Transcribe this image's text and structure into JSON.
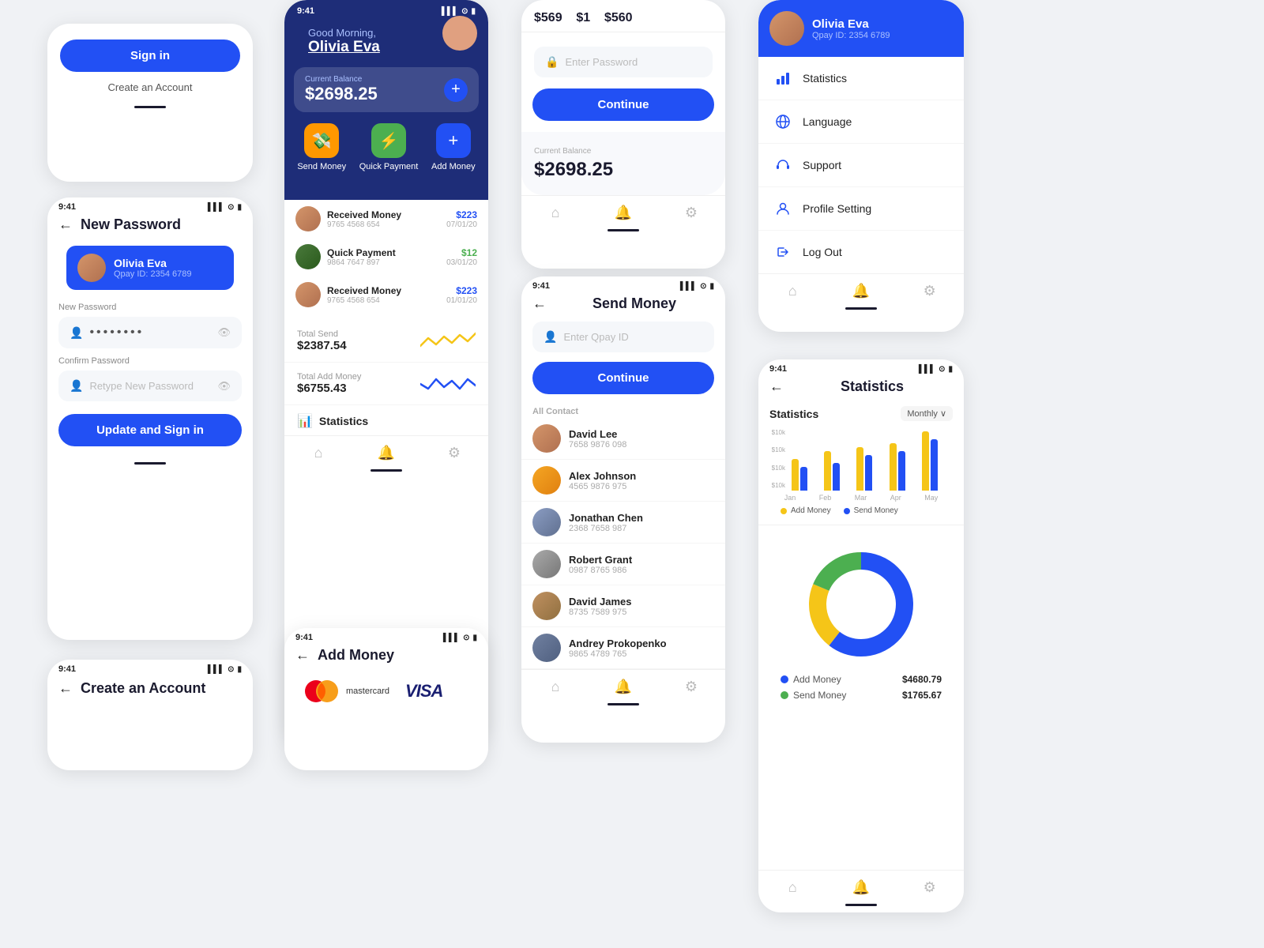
{
  "status": {
    "time": "9:41",
    "signal": "▌▌▌",
    "wifi": "WiFi",
    "battery": "🔋"
  },
  "signin": {
    "title": "Sign in",
    "create_account": "Create an Account"
  },
  "new_password": {
    "title": "New Password",
    "user_name": "Olivia Eva",
    "user_id": "Qpay ID: 2354 6789",
    "new_password_label": "New Password",
    "dots": "••••••••",
    "confirm_label": "Confirm Password",
    "retype_placeholder": "Retype New Password",
    "update_btn": "Update and Sign in"
  },
  "create_account": {
    "title": "Create an Account"
  },
  "dashboard": {
    "greeting": "Good Morning,",
    "name": "Olivia Eva",
    "balance_label": "Current Balance",
    "balance": "$2698.25",
    "actions": [
      {
        "label": "Send Money",
        "icon": "💸"
      },
      {
        "label": "Quick Payment",
        "icon": "⚡"
      },
      {
        "label": "Add Money",
        "icon": "+"
      }
    ],
    "total_send_label": "Total Send",
    "total_send": "$2387.54",
    "total_add_label": "Total Add Money",
    "total_add": "$6755.43",
    "statistics_label": "Statistics",
    "transactions": [
      {
        "name": "Received Money",
        "num": "9765 4568 654",
        "amount": "$223",
        "date": "07/01/20"
      },
      {
        "name": "Quick Payment",
        "num": "9864 7647 897",
        "amount": "$12",
        "date": "03/01/20"
      },
      {
        "name": "Received Money",
        "num": "9765 4568 654",
        "amount": "$223",
        "date": "01/01/20"
      }
    ]
  },
  "addmoney": {
    "title": "Add Money"
  },
  "enter_password": {
    "label": "Enter Password",
    "continue_btn": "Continue",
    "amounts": [
      "$569",
      "$1",
      "$560"
    ]
  },
  "balance_card": {
    "label": "Current Balance",
    "amount": "$2698.25"
  },
  "send_money": {
    "title": "Send Money",
    "qpay_placeholder": "Enter Qpay ID",
    "continue_btn": "Continue",
    "all_contact_label": "All Contact",
    "contacts": [
      {
        "name": "David Lee",
        "num": "7658 9876 098"
      },
      {
        "name": "Alex Johnson",
        "num": "4565 9876 975"
      },
      {
        "name": "Jonathan Chen",
        "num": "2368 7658 987"
      },
      {
        "name": "Robert Grant",
        "num": "0987 8765 986"
      },
      {
        "name": "David James",
        "num": "8735 7589 975"
      },
      {
        "name": "Andrey Prokopenko",
        "num": "9865 4789 765"
      }
    ]
  },
  "profile_menu": {
    "user_name": "Olivia Eva",
    "user_id": "Qpay ID: 2354 6789",
    "items": [
      {
        "label": "Statistics",
        "icon": "bar_chart"
      },
      {
        "label": "Language",
        "icon": "language"
      },
      {
        "label": "Support",
        "icon": "headset"
      },
      {
        "label": "Profile Setting",
        "icon": "person"
      },
      {
        "label": "Log Out",
        "icon": "logout"
      }
    ]
  },
  "statistics": {
    "title": "Statistics",
    "chart_title": "Statistics",
    "filter": "Monthly ∨",
    "months": [
      "Jan",
      "Feb",
      "Mar",
      "Apr",
      "May"
    ],
    "bars": {
      "add_money": [
        40,
        50,
        55,
        60,
        75
      ],
      "send_money": [
        30,
        35,
        45,
        50,
        65
      ]
    },
    "legend_add": "Add Money",
    "legend_send": "Send Money",
    "donut": {
      "add_money_label": "Add Money",
      "add_money_value": "$4680.79",
      "send_money_label": "Send Money",
      "send_money_value": "$1765.67"
    }
  }
}
